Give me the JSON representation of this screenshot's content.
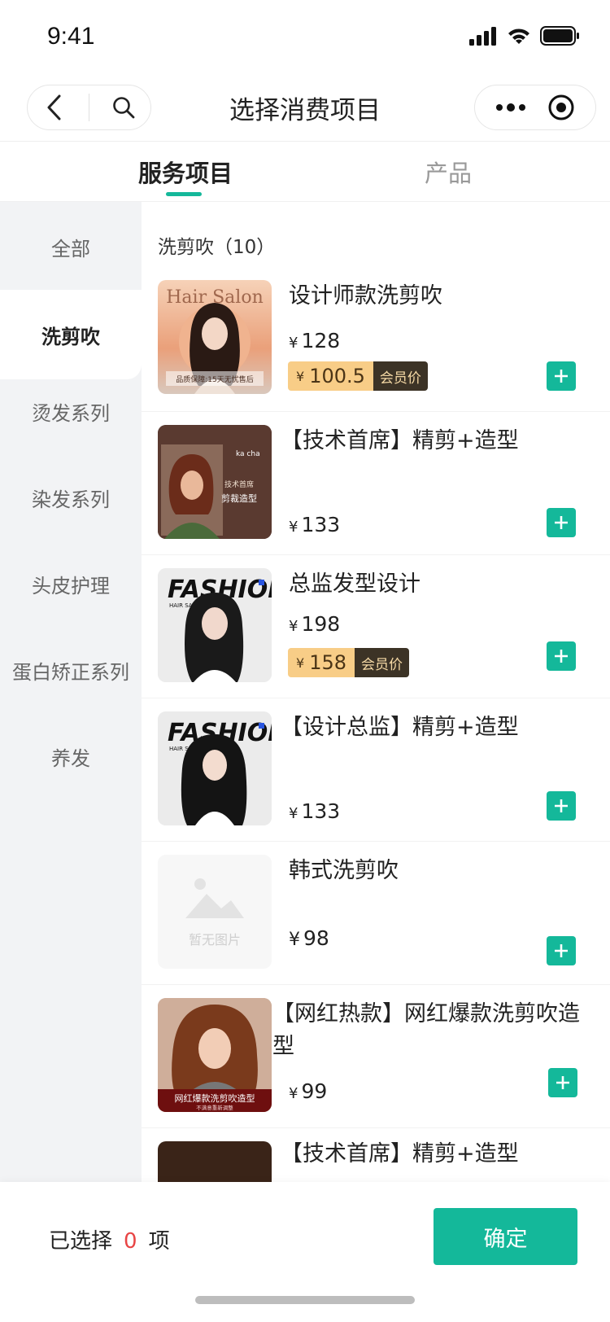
{
  "status_bar": {
    "time": "9:41"
  },
  "nav": {
    "title": "选择消费项目"
  },
  "tabs": [
    {
      "label": "服务项目",
      "active": true
    },
    {
      "label": "产品",
      "active": false
    }
  ],
  "sidebar": {
    "items": [
      {
        "label": "全部"
      },
      {
        "label": "洗剪吹",
        "active": true
      },
      {
        "label": "烫发系列"
      },
      {
        "label": "染发系列"
      },
      {
        "label": "头皮护理"
      },
      {
        "label": "蛋白矫正系列"
      },
      {
        "label": "养发"
      }
    ]
  },
  "section": {
    "title": "洗剪吹（10）"
  },
  "currency": "¥",
  "member_label": "会员价",
  "products": [
    {
      "name": "设计师款洗剪吹",
      "price": "128",
      "member_price": "100.5",
      "image_text": [
        "Hair Salon",
        "品质保障:15天无忧售后"
      ]
    },
    {
      "name": "【技术首席】精剪+造型",
      "price": "133",
      "image_text": [
        "ka cha",
        "技术首席",
        "剪裁造型"
      ]
    },
    {
      "name": "总监发型设计",
      "price": "198",
      "member_price": "158",
      "image_text": [
        "FASHION",
        "HAIR SALON"
      ]
    },
    {
      "name": "【设计总监】精剪+造型",
      "price": "133",
      "image_text": [
        "FASHION",
        "HAIR SALON"
      ]
    },
    {
      "name": "韩式洗剪吹",
      "price": "98",
      "image_text": [
        "暂无图片"
      ]
    },
    {
      "name": "【网红热款】网红爆款洗剪吹造型",
      "price": "99",
      "image_text": [
        "网红爆款洗剪吹造型",
        "不满意重新调整"
      ]
    },
    {
      "name": "【技术首席】精剪+造型"
    }
  ],
  "bottom_bar": {
    "selected_prefix": "已选择",
    "selected_count": "0",
    "selected_suffix": "项",
    "confirm_label": "确定"
  },
  "colors": {
    "accent": "#14b89a",
    "member_price_bg": "#f8cd87",
    "member_label_bg": "#3c3326",
    "count_color": "#e84545"
  }
}
